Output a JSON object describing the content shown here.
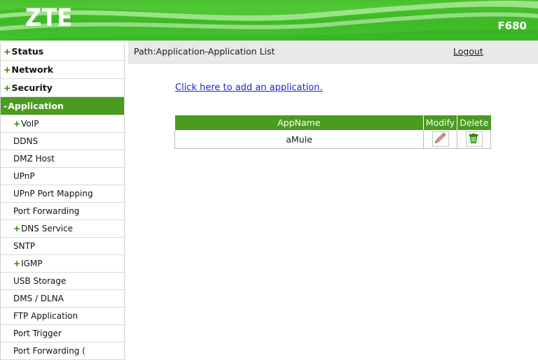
{
  "header": {
    "logo": "ZTE",
    "model": "F680",
    "brand_green": "#43c22c"
  },
  "sidebar": {
    "active_green": "#4b9b1e",
    "items": [
      {
        "label": "Status",
        "marker": "+",
        "level": "top",
        "active": false
      },
      {
        "label": "Network",
        "marker": "+",
        "level": "top",
        "active": false
      },
      {
        "label": "Security",
        "marker": "+",
        "level": "top",
        "active": false
      },
      {
        "label": "Application",
        "marker": "-",
        "level": "top",
        "active": true
      },
      {
        "label": "VoIP",
        "marker": "+",
        "level": "sub",
        "active": false
      },
      {
        "label": "DDNS",
        "marker": "",
        "level": "sub",
        "active": false
      },
      {
        "label": "DMZ Host",
        "marker": "",
        "level": "sub",
        "active": false
      },
      {
        "label": "UPnP",
        "marker": "",
        "level": "sub",
        "active": false
      },
      {
        "label": "UPnP Port Mapping",
        "marker": "",
        "level": "sub",
        "active": false
      },
      {
        "label": "Port Forwarding",
        "marker": "",
        "level": "sub",
        "active": false
      },
      {
        "label": "DNS Service",
        "marker": "+",
        "level": "sub",
        "active": false
      },
      {
        "label": "SNTP",
        "marker": "",
        "level": "sub",
        "active": false
      },
      {
        "label": "IGMP",
        "marker": "+",
        "level": "sub",
        "active": false
      },
      {
        "label": "USB Storage",
        "marker": "",
        "level": "sub",
        "active": false
      },
      {
        "label": "DMS / DLNA",
        "marker": "",
        "level": "sub",
        "active": false
      },
      {
        "label": "FTP Application",
        "marker": "",
        "level": "sub",
        "active": false
      },
      {
        "label": "Port Trigger",
        "marker": "",
        "level": "sub",
        "active": false
      },
      {
        "label": "Port Forwarding (",
        "marker": "",
        "level": "sub",
        "active": false
      }
    ]
  },
  "main": {
    "path": "Path:Application-Application List",
    "logout_label": "Logout",
    "add_link_label": "Click here to add an application.",
    "table": {
      "columns": [
        "AppName",
        "Modify",
        "Delete"
      ],
      "rows": [
        {
          "appname": "aMule",
          "modify_icon": "pencil-icon",
          "delete_icon": "trash-icon"
        }
      ]
    }
  }
}
